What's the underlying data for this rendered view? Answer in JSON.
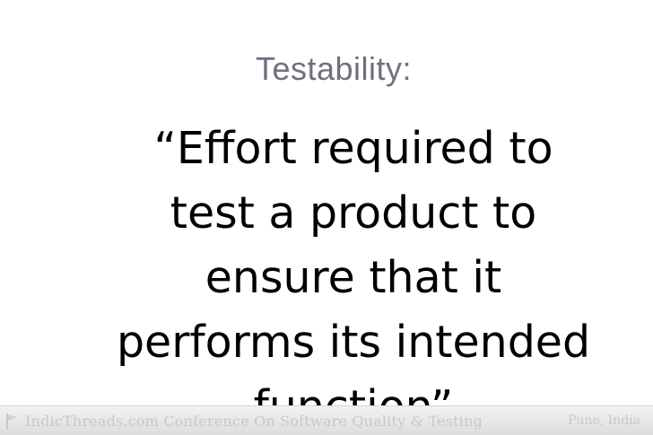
{
  "slide": {
    "title": "Testability:",
    "quote_lines": [
      "“Effort required to",
      "test a product to",
      "ensure that it",
      "performs its intended",
      "function”"
    ]
  },
  "footer": {
    "brand": "IndicThreads.com Conference On Software Quality & Testing",
    "location": "Pune, India",
    "logo_icon": "flag-mark-icon"
  },
  "colors": {
    "title": "#6f6f80",
    "quote": "#000000",
    "footer_text": "#c8c8c8",
    "footer_bg": "#e6e6e6"
  }
}
